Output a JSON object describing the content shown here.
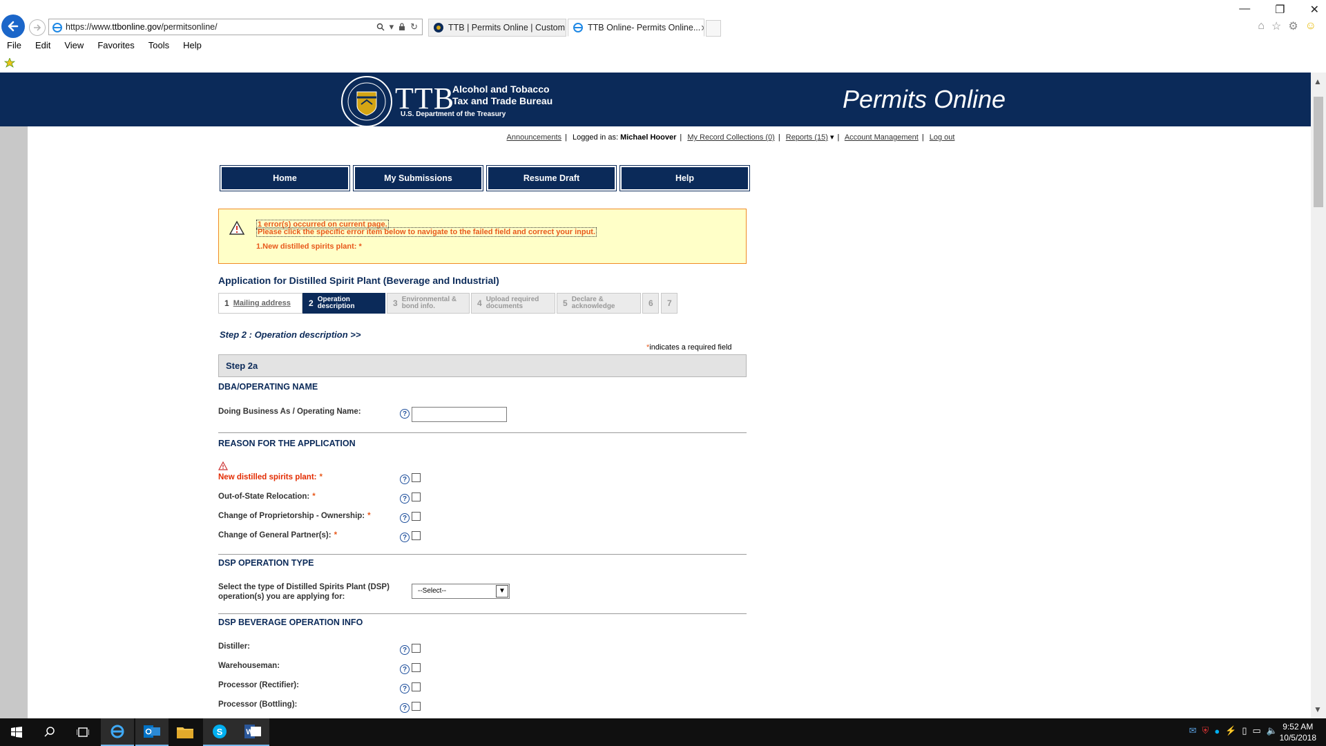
{
  "browser": {
    "url_prefix": "https://www.",
    "url_domain": "ttbonline.gov",
    "url_path": "/permitsonline/",
    "tabs": [
      {
        "label": "TTB | Permits Online | Custom...",
        "active": false
      },
      {
        "label": "TTB Online- Permits Online...",
        "active": true
      }
    ],
    "menu": [
      "File",
      "Edit",
      "View",
      "Favorites",
      "Tools",
      "Help"
    ]
  },
  "banner": {
    "acronym": "TTB",
    "line1": "Alcohol and Tobacco",
    "line2": "Tax and Trade Bureau",
    "line3": "U.S. Department of the Treasury",
    "title": "Permits Online",
    "color": "#0b2a59"
  },
  "topnav": {
    "announcements": "Announcements",
    "logged_in_prefix": "Logged in as:",
    "user": "Michael Hoover",
    "collections": "My Record Collections (0)",
    "reports": "Reports (15)",
    "account": "Account Management",
    "logout": "Log out"
  },
  "mainnav": [
    "Home",
    "My Submissions",
    "Resume Draft",
    "Help"
  ],
  "errors": {
    "line1": "1 error(s) occurred on current page.",
    "line2": "Please click the specific error item below to navigate to the failed field and correct your input.",
    "item1": "1.New distilled spirits plant: *"
  },
  "form": {
    "app_title": "Application for Distilled Spirit Plant (Beverage and Industrial)",
    "steps": [
      {
        "num": "1",
        "label": "Mailing address"
      },
      {
        "num": "2",
        "label1": "Operation",
        "label2": "description"
      },
      {
        "num": "3",
        "label1": "Environmental &",
        "label2": "bond info."
      },
      {
        "num": "4",
        "label1": "Upload required",
        "label2": "documents"
      },
      {
        "num": "5",
        "label1": "Declare &",
        "label2": "acknowledge"
      },
      {
        "num": "6"
      },
      {
        "num": "7"
      }
    ],
    "step_heading": "Step 2 : Operation description >>",
    "required_note": "indicates a required field",
    "required_star": "*",
    "substep": "Step 2a",
    "sections": {
      "dba": "DBA/OPERATING NAME",
      "reason": "REASON FOR THE APPLICATION",
      "dsp_type": "DSP OPERATION TYPE",
      "dsp_bev": "DSP BEVERAGE OPERATION INFO"
    },
    "dba_label": "Doing Business As / Operating Name:",
    "dba_value": "",
    "reasons": [
      {
        "label": "New distilled spirits plant:",
        "error": true
      },
      {
        "label": "Out-of-State Relocation:",
        "error": false
      },
      {
        "label": "Change of Proprietorship - Ownership:",
        "error": false
      },
      {
        "label": "Change of General Partner(s):",
        "error": false
      }
    ],
    "dsp_type_label1": "Select the type of Distilled Spirits Plant (DSP)",
    "dsp_type_label2": "operation(s) you are applying for:",
    "dsp_type_value": "--Select--",
    "bev_ops": [
      "Distiller:",
      "Warehouseman:",
      "Processor (Rectifier):",
      "Processor (Bottling):"
    ],
    "help_glyph": "?"
  },
  "taskbar": {
    "time": "9:52 AM",
    "date": "10/5/2018",
    "apps": [
      "windows-start",
      "search",
      "task-view",
      "internet-explorer",
      "outlook",
      "file-explorer",
      "skype",
      "word"
    ]
  }
}
